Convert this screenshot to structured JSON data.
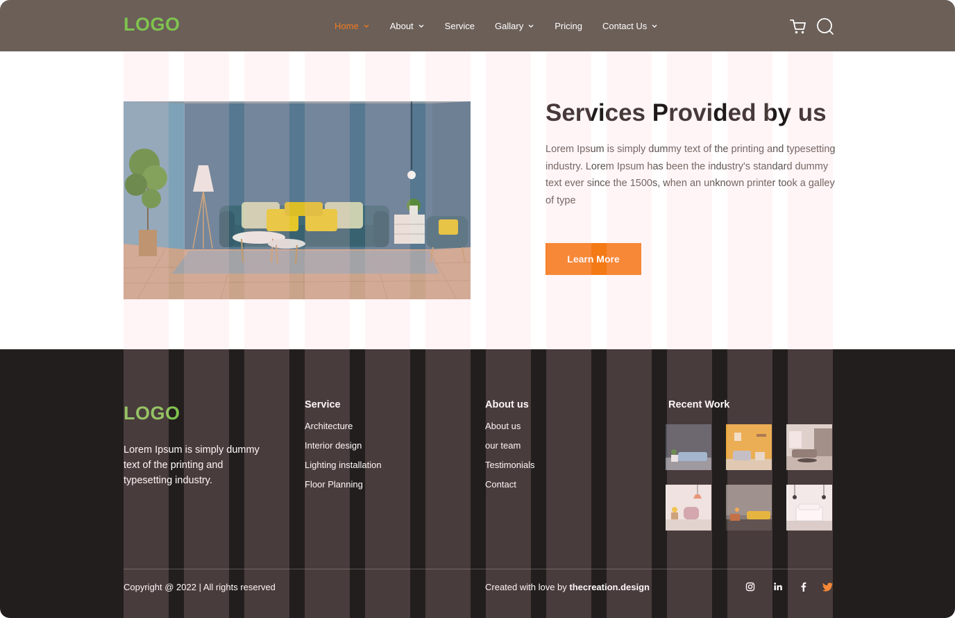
{
  "header": {
    "logo": "LOGO",
    "nav": [
      {
        "label": "Home",
        "dropdown": true,
        "active": true
      },
      {
        "label": "About",
        "dropdown": true
      },
      {
        "label": "Service",
        "dropdown": false
      },
      {
        "label": "Gallary",
        "dropdown": true
      },
      {
        "label": "Pricing",
        "dropdown": false
      },
      {
        "label": "Contact Us",
        "dropdown": true
      }
    ],
    "icons": [
      "cart-icon",
      "search-icon"
    ]
  },
  "hero": {
    "title": "Services Provided by us",
    "text": "Lorem Ipsum is simply dummy text of the printing and typesetting industry. Lorem Ipsum has been the industry's standard dummy text ever since the 1500s, when an unknown printer took a galley of type",
    "button": "Learn More"
  },
  "footer": {
    "logo": "LOGO",
    "description": "Lorem Ipsum is simply dummy text of the printing and typesetting industry.",
    "service": {
      "heading": "Service",
      "links": [
        "Architecture",
        "Interior design",
        "Lighting installation",
        "Floor Planning"
      ]
    },
    "about": {
      "heading": "About us",
      "links": [
        "About us",
        "our team",
        "Testimonials",
        "Contact"
      ]
    },
    "recent": {
      "heading": "Recent Work"
    },
    "copyright": "Copyright @ 2022 | All rights reserved",
    "credit_prefix": "Created with love by ",
    "credit_brand": "thecreation.design",
    "social_icons": [
      "instagram-icon",
      "linkedin-icon",
      "facebook-icon",
      "twitter-icon"
    ]
  },
  "colors": {
    "accent": "#f47a16",
    "logo": "#7fc34f",
    "header_bg": "#6b5f58",
    "footer_bg": "#221e1d",
    "twitter": "#f47a16"
  }
}
